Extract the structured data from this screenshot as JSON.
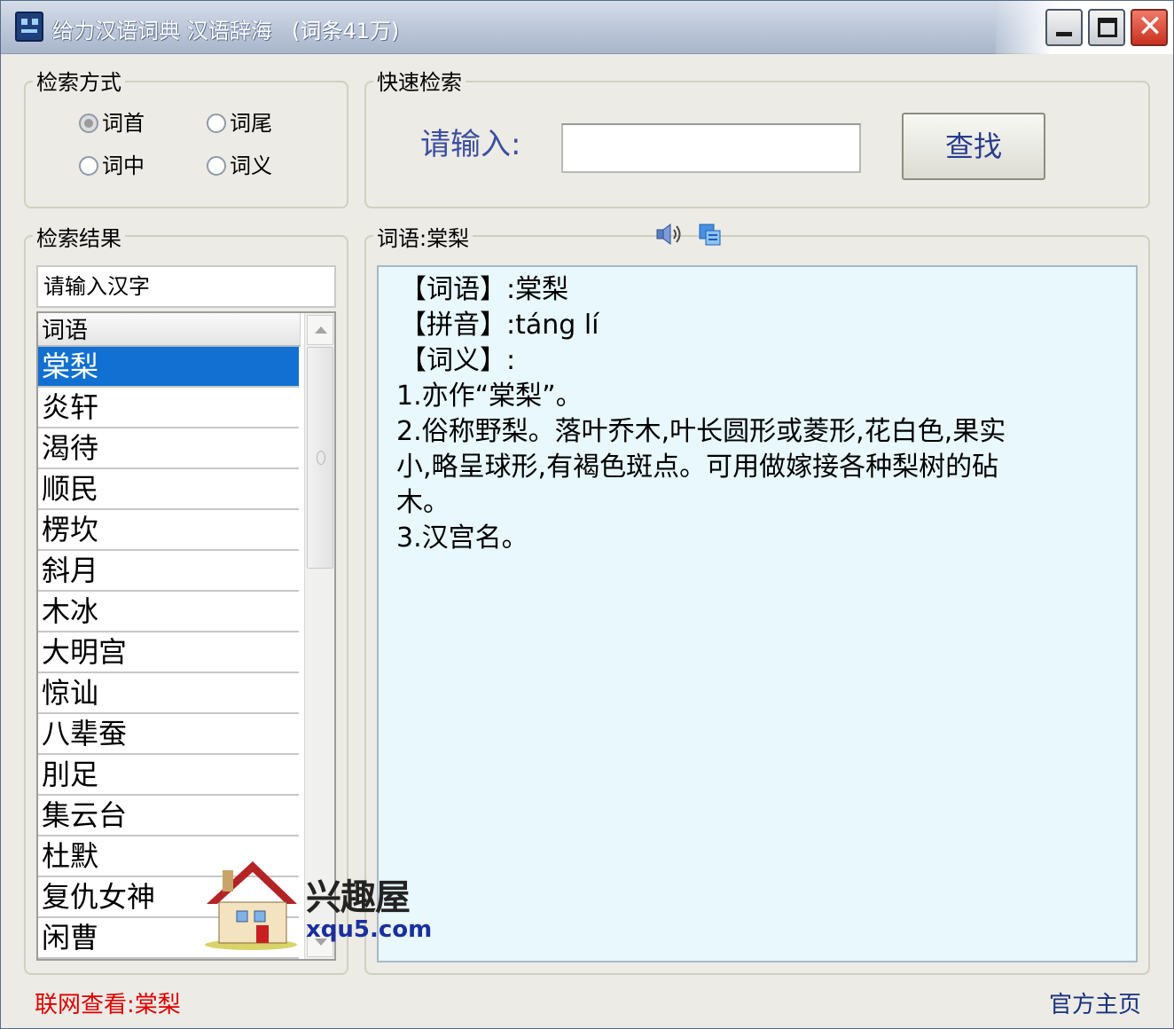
{
  "window": {
    "title": "给力汉语词典 汉语辞海",
    "count": "(词条41万)",
    "close_glyph": "✕"
  },
  "search_mode": {
    "title": "检索方式",
    "options": [
      {
        "label": "词首",
        "checked": true
      },
      {
        "label": "词尾",
        "checked": false
      },
      {
        "label": "词中",
        "checked": false
      },
      {
        "label": "词义",
        "checked": false
      }
    ]
  },
  "quick_search": {
    "title": "快速检索",
    "prompt": "请输入:",
    "input_value": "",
    "button_label": "查找"
  },
  "results": {
    "title": "检索结果",
    "filter_value": "请输入汉字",
    "column_header": "词语",
    "items": [
      "棠梨",
      "炎轩",
      "渴待",
      "顺民",
      "楞坎",
      "斜月",
      "木冰",
      "大明宫",
      "惊讪",
      "八辈蚕",
      "刖足",
      "集云台",
      "杜默",
      "复仇女神",
      "闲曹"
    ],
    "selected_index": 0
  },
  "detail": {
    "title": "词语:棠梨",
    "speaker_icon": "speaker-icon",
    "copy_icon": "copy-icon",
    "lines": [
      "【词语】:棠梨",
      "【拼音】:táng lí",
      "【词义】:",
      "1.亦作“棠梨”。",
      "2.俗称野梨。落叶乔木,叶长圆形或菱形,花白色,果实",
      "小,略呈球形,有褐色斑点。可用做嫁接各种梨树的砧",
      "木。",
      "3.汉宫名。"
    ]
  },
  "footer": {
    "online_lookup": "联网查看:棠梨",
    "homepage": "官方主页"
  },
  "watermark": {
    "name": "兴趣屋",
    "url": "xqu5.com"
  },
  "colors": {
    "selected_row": "#1170d1",
    "detail_bg": "#e8f8fd",
    "footer_link_red": "#e00000",
    "footer_link_blue": "#16317e",
    "prompt_blue": "#3b4fa0"
  }
}
